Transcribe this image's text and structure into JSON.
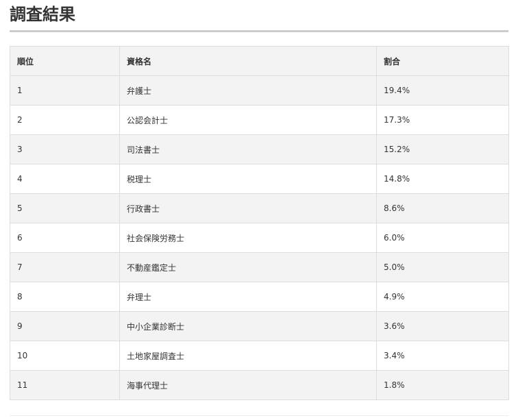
{
  "page": {
    "title": "調査結果"
  },
  "table": {
    "headers": [
      "順位",
      "資格名",
      "割合"
    ],
    "rows": [
      [
        "1",
        "弁護士",
        "19.4%"
      ],
      [
        "2",
        "公認会計士",
        "17.3%"
      ],
      [
        "3",
        "司法書士",
        "15.2%"
      ],
      [
        "4",
        "税理士",
        "14.8%"
      ],
      [
        "5",
        "行政書士",
        "8.6%"
      ],
      [
        "6",
        "社会保険労務士",
        "6.0%"
      ],
      [
        "7",
        "不動産鑑定士",
        "5.0%"
      ],
      [
        "8",
        "弁理士",
        "4.9%"
      ],
      [
        "9",
        "中小企業診断士",
        "3.6%"
      ],
      [
        "10",
        "土地家屋調査士",
        "3.4%"
      ],
      [
        "11",
        "海事代理士",
        "1.8%"
      ]
    ]
  }
}
